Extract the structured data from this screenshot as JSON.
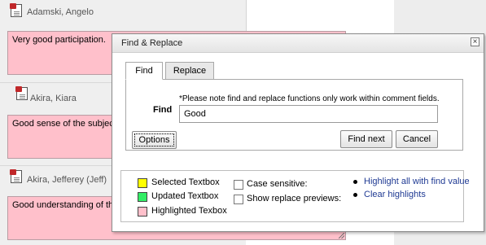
{
  "students": [
    {
      "name": "Adamski, Angelo",
      "comment": "Very good participation."
    },
    {
      "name": "Akira, Kiara",
      "comment": "Good sense of the subjec"
    },
    {
      "name": "Akira, Jefferey (Jeff)",
      "comment": "Good understanding of the"
    }
  ],
  "dialog": {
    "title": "Find & Replace",
    "tabs": {
      "find": "Find",
      "replace": "Replace"
    },
    "note": "*Please note find and replace functions only work within comment fields.",
    "find_label": "Find",
    "find_value": "Good",
    "options_label": "Options",
    "find_next_label": "Find next",
    "cancel_label": "Cancel",
    "legend": {
      "selected": "Selected Textbox",
      "updated": "Updated Textbox",
      "highlighted": "Highlighted Texbox"
    },
    "checkboxes": {
      "case_sensitive": "Case sensitive:",
      "replace_previews": "Show replace previews:"
    },
    "links": {
      "highlight_all": "Highlight all with find value",
      "clear_highlights": "Clear highlights"
    }
  },
  "colors": {
    "selected": "#ffff00",
    "updated": "#33ee66",
    "highlighted": "#ffc0cb",
    "link": "#1f3a93"
  }
}
